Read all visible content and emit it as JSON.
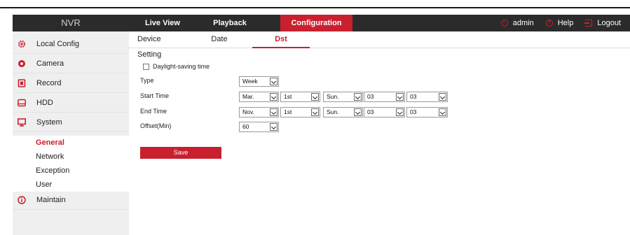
{
  "header": {
    "brand": "NVR",
    "nav": [
      {
        "label": "Live View"
      },
      {
        "label": "Playback"
      },
      {
        "label": "Configuration",
        "active": true
      }
    ],
    "user": {
      "admin_label": "admin",
      "help_label": "Help",
      "logout_label": "Logout"
    },
    "accent_color": "#c8202e",
    "bar_color": "#2b2b2b"
  },
  "sidebar": {
    "items": [
      {
        "label": "Local Config",
        "icon": "gear-icon"
      },
      {
        "label": "Camera",
        "icon": "camera-icon"
      },
      {
        "label": "Record",
        "icon": "record-icon"
      },
      {
        "label": "HDD",
        "icon": "hdd-icon"
      },
      {
        "label": "System",
        "icon": "monitor-icon"
      },
      {
        "label": "Maintain",
        "icon": "info-icon"
      }
    ],
    "system_sub": [
      {
        "label": "General",
        "active": true
      },
      {
        "label": "Network"
      },
      {
        "label": "Exception"
      },
      {
        "label": "User"
      }
    ]
  },
  "tabs": [
    {
      "label": "Device Setting"
    },
    {
      "label": "Date"
    },
    {
      "label": "Dst",
      "active": true
    }
  ],
  "form": {
    "dst_checkbox_label": "Daylight-saving time",
    "dst_checked": false,
    "type_label": "Type",
    "type_value": "Week",
    "start_label": "Start Time",
    "start": {
      "month": "Mar.",
      "week": "1st",
      "day": "Sun.",
      "hour": "03",
      "minute": "03"
    },
    "end_label": "End Time",
    "end": {
      "month": "Nov.",
      "week": "1st",
      "day": "Sun.",
      "hour": "03",
      "minute": "03"
    },
    "offset_label": "Offset(Min)",
    "offset_value": "60",
    "save_label": "Save"
  }
}
